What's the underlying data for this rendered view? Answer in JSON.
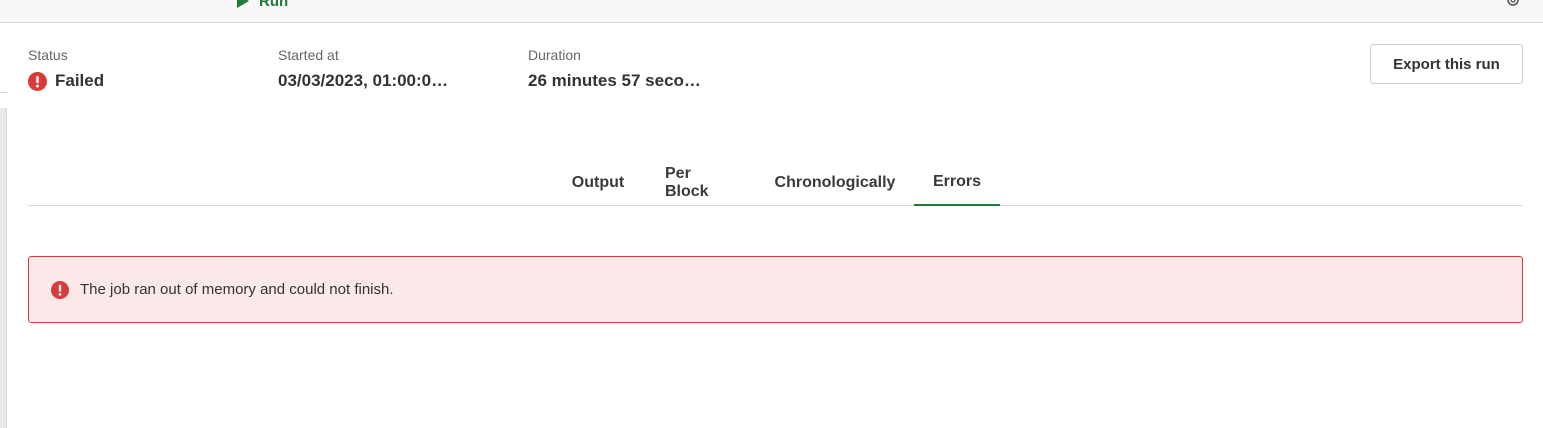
{
  "toolbar": {
    "run_label": "Run",
    "run_icon": "play-icon",
    "settings_icon": "gear-icon"
  },
  "summary": {
    "status_label": "Status",
    "status_value": "Failed",
    "status_icon": "error-icon",
    "started_label": "Started at",
    "started_value": "03/03/2023, 01:00:0…",
    "duration_label": "Duration",
    "duration_value": "26 minutes 57 seco…"
  },
  "export_button": "Export this run",
  "tabs": [
    {
      "label": "Output",
      "active": false
    },
    {
      "label": "Per Block",
      "active": false
    },
    {
      "label": "Chronologically",
      "active": false
    },
    {
      "label": "Errors",
      "active": true
    }
  ],
  "error": {
    "icon": "error-icon",
    "message": "The job ran out of memory and could not finish."
  },
  "colors": {
    "accent": "#1f7a3a",
    "error": "#d93a3a",
    "error_background": "#fbe9e9"
  }
}
